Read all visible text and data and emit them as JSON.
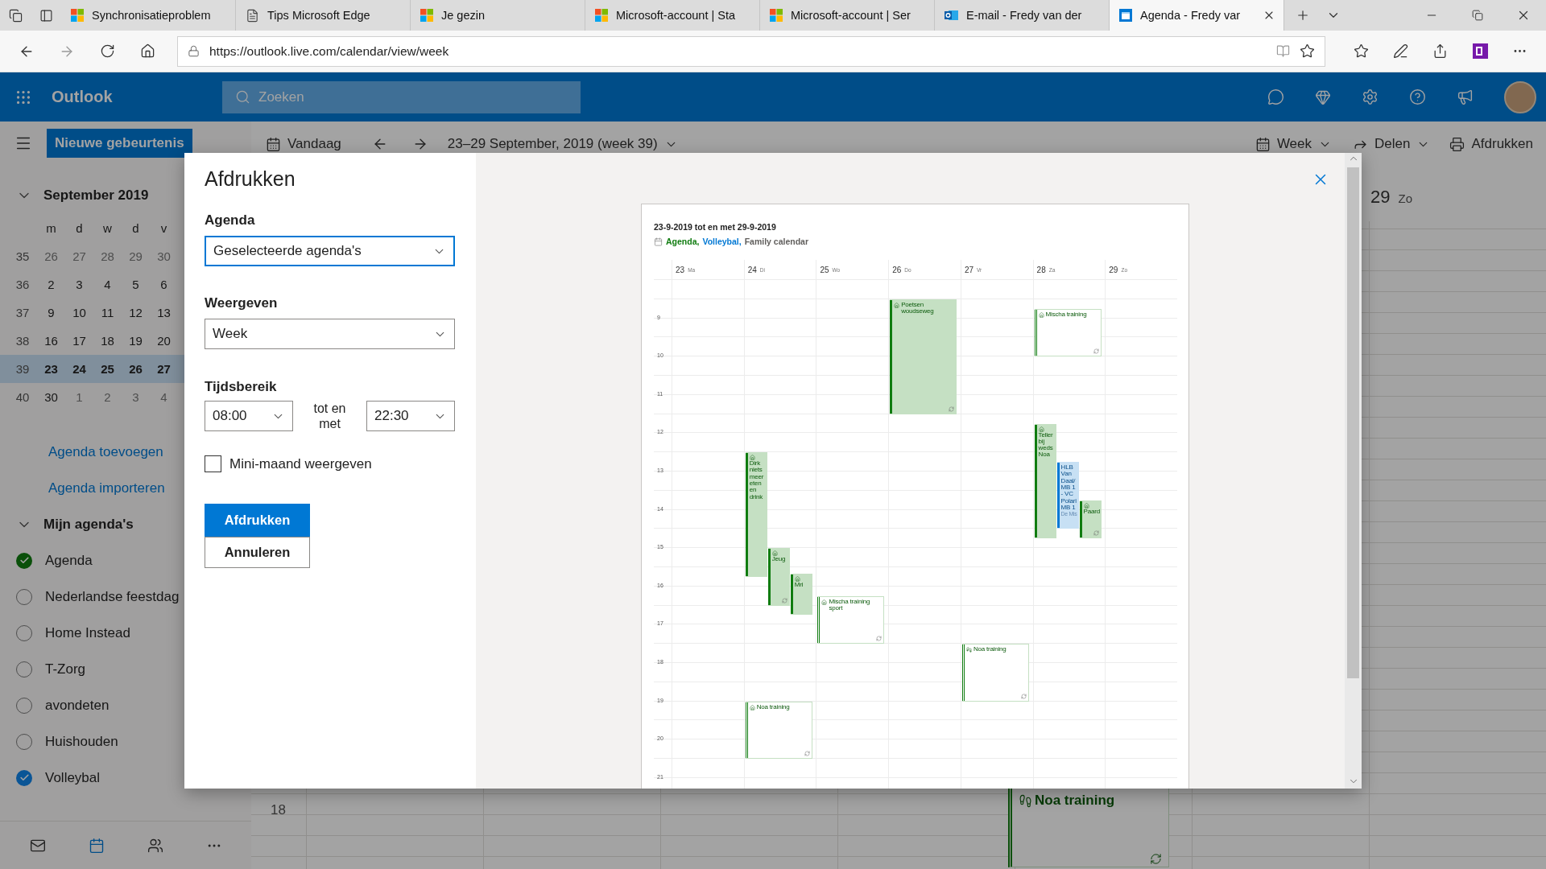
{
  "browser": {
    "tabs": [
      {
        "title": "Synchronisatieproblem",
        "kind": "microsoft",
        "selected": false
      },
      {
        "title": "Tips Microsoft Edge",
        "kind": "page",
        "selected": false
      },
      {
        "title": "Je gezin",
        "kind": "microsoft",
        "selected": false
      },
      {
        "title": "Microsoft-account | Sta",
        "kind": "microsoft",
        "selected": false
      },
      {
        "title": "Microsoft-account | Ser",
        "kind": "microsoft",
        "selected": false
      },
      {
        "title": "E-mail - Fredy van der",
        "kind": "outlook",
        "selected": false
      },
      {
        "title": "Agenda - Fredy var",
        "kind": "calendar",
        "selected": true
      }
    ],
    "url": "https://outlook.live.com/calendar/view/week"
  },
  "outlook": {
    "app_name": "Outlook",
    "search_placeholder": "Zoeken"
  },
  "sidebar": {
    "new_event_button": "Nieuwe gebeurtenis",
    "mini_calendar": {
      "month": "September 2019",
      "expanded": true,
      "weekday_headers": [
        "m",
        "d",
        "w",
        "d",
        "v"
      ],
      "weeks": [
        {
          "number": "35",
          "selected": false,
          "days": [
            {
              "label": "26",
              "muted": true
            },
            {
              "label": "27",
              "muted": true
            },
            {
              "label": "28",
              "muted": true
            },
            {
              "label": "29",
              "muted": true
            },
            {
              "label": "30",
              "muted": true
            }
          ]
        },
        {
          "number": "36",
          "selected": false,
          "days": [
            {
              "label": "2",
              "muted": false
            },
            {
              "label": "3",
              "muted": false
            },
            {
              "label": "4",
              "muted": false
            },
            {
              "label": "5",
              "muted": false
            },
            {
              "label": "6",
              "muted": false
            }
          ]
        },
        {
          "number": "37",
          "selected": false,
          "days": [
            {
              "label": "9",
              "muted": false
            },
            {
              "label": "10",
              "muted": false
            },
            {
              "label": "11",
              "muted": false
            },
            {
              "label": "12",
              "muted": false
            },
            {
              "label": "13",
              "muted": false
            }
          ]
        },
        {
          "number": "38",
          "selected": false,
          "days": [
            {
              "label": "16",
              "muted": false
            },
            {
              "label": "17",
              "muted": false
            },
            {
              "label": "18",
              "muted": false
            },
            {
              "label": "19",
              "muted": false
            },
            {
              "label": "20",
              "muted": false
            }
          ]
        },
        {
          "number": "39",
          "selected": true,
          "days": [
            {
              "label": "23",
              "muted": false
            },
            {
              "label": "24",
              "muted": false
            },
            {
              "label": "25",
              "muted": false
            },
            {
              "label": "26",
              "muted": false
            },
            {
              "label": "27",
              "muted": false
            }
          ]
        },
        {
          "number": "40",
          "selected": false,
          "days": [
            {
              "label": "30",
              "muted": false
            },
            {
              "label": "1",
              "muted": true
            },
            {
              "label": "2",
              "muted": true
            },
            {
              "label": "3",
              "muted": true
            },
            {
              "label": "4",
              "muted": true
            }
          ]
        }
      ]
    },
    "links": [
      "Agenda toevoegen",
      "Agenda importeren"
    ],
    "my_calendars": {
      "title": "Mijn agenda's",
      "expanded": true,
      "items": [
        {
          "name": "Agenda",
          "checked": true,
          "color": "#0a500a"
        },
        {
          "name": "Nederlandse feestdag",
          "checked": false
        },
        {
          "name": "Home Instead",
          "checked": false
        },
        {
          "name": "T-Zorg",
          "checked": false
        },
        {
          "name": "avondeten",
          "checked": false
        },
        {
          "name": "Huishouden",
          "checked": false
        },
        {
          "name": "Volleybal",
          "checked": true,
          "color": "#0a5596"
        }
      ]
    }
  },
  "toolbar": {
    "today": "Vandaag",
    "date_range": "23–29 September, 2019 (week 39)",
    "view": "Week",
    "share": "Delen",
    "print": "Afdrukken"
  },
  "background_week": {
    "day": {
      "num": "29",
      "abbr": "Zo"
    },
    "hour_label": "18",
    "event": {
      "title": "Noa training",
      "kind": "shoe",
      "recurring": true
    }
  },
  "print_dialog": {
    "title": "Afdrukken",
    "fields": [
      {
        "label": "Agenda",
        "value": "Geselecteerde agenda's",
        "focused": true
      },
      {
        "label": "Weergeven",
        "value": "Week",
        "focused": false
      }
    ],
    "time_range": {
      "label": "Tijdsbereik",
      "from": "08:00",
      "separator": "tot en met",
      "to": "22:30"
    },
    "mini_month": {
      "label": "Mini-maand weergeven",
      "checked": false
    },
    "buttons": [
      {
        "label": "Afdrukken",
        "primary": true
      },
      {
        "label": "Annuleren",
        "primary": false
      }
    ],
    "preview": {
      "title": "23-9-2019 tot en met 29-9-2019",
      "calendars": [
        {
          "name": "Agenda,",
          "color": "#107c10"
        },
        {
          "name": "Volleybal,",
          "color": "#0078d4"
        },
        {
          "name": "Family calendar",
          "color": "#605e5c"
        }
      ],
      "hours": [
        "9",
        "10",
        "11",
        "12",
        "13",
        "14",
        "15",
        "16",
        "17",
        "18",
        "19",
        "20",
        "21"
      ],
      "days": [
        {
          "num": "23",
          "abbr": "Ma"
        },
        {
          "num": "24",
          "abbr": "Di",
          "events": [
            {
              "title": "Dirk niets meer eten en drink",
              "kind": "home",
              "busy": true,
              "color": "#107c10",
              "recurring": false
            },
            {
              "title": "Jeug",
              "kind": "home",
              "busy": true,
              "color": "#107c10",
              "recurring": true
            },
            {
              "title": "Mri",
              "kind": "home",
              "busy": true,
              "color": "#107c10",
              "recurring": false
            },
            {
              "title": "Noa training",
              "kind": "home",
              "busy": false,
              "color": "#107c10",
              "recurring": true
            }
          ]
        },
        {
          "num": "25",
          "abbr": "Wo",
          "events": [
            {
              "title": "Mischa training sport",
              "kind": "home",
              "busy": false,
              "color": "#107c10",
              "recurring": true
            }
          ]
        },
        {
          "num": "26",
          "abbr": "Do",
          "events": [
            {
              "title": "Poetsen woudseweg",
              "kind": "home",
              "busy": true,
              "color": "#107c10",
              "recurring": true
            }
          ]
        },
        {
          "num": "27",
          "abbr": "Vr",
          "events": [
            {
              "title": "Noa training",
              "kind": "shoe",
              "busy": false,
              "color": "#107c10",
              "recurring": true
            }
          ]
        },
        {
          "num": "28",
          "abbr": "Za",
          "events": [
            {
              "title": "Mischa training",
              "kind": "home",
              "busy": false,
              "color": "#107c10",
              "recurring": true
            },
            {
              "title": "Teller bij weds Noa",
              "kind": "home",
              "busy": true,
              "color": "#107c10",
              "recurring": false
            },
            {
              "title": "HLB Van Daal/ MB 1 - VC Polari MB 1",
              "location": "De Mis",
              "kind": "plain",
              "busy": true,
              "color": "#0078d4",
              "recurring": false
            },
            {
              "title": "Paard",
              "kind": "home",
              "busy": true,
              "color": "#107c10",
              "recurring": true
            }
          ]
        },
        {
          "num": "29",
          "abbr": "Zo"
        }
      ]
    }
  }
}
